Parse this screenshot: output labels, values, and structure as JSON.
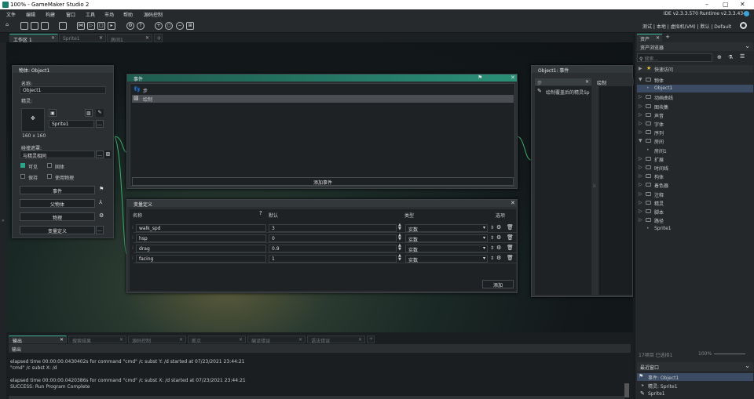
{
  "window": {
    "title": "100% - GameMaker Studio 2"
  },
  "menu": [
    "文件",
    "编辑",
    "构建",
    "窗口",
    "工具",
    "市场",
    "帮助",
    "源码控制"
  ],
  "version": "IDE v2.3.3.570  Runtime v2.3.3.434",
  "toolbar_right": "测试 | 本地 | 虚拟机(VM) | 默认 | Default",
  "workspace_tabs": [
    {
      "label": "工作区 1"
    },
    {
      "label": "Sprite1"
    },
    {
      "label": "房间1"
    }
  ],
  "object_panel": {
    "header": "物体: Object1",
    "name_label": "名称:",
    "name_value": "Object1",
    "sprite_label": "精灵:",
    "sprite_name": "Sprite1",
    "sprite_size": "160 x 160",
    "collision_label": "碰撞遮罩:",
    "collision_value": "与精灵相同",
    "visible": "可见",
    "solid": "固体",
    "persistent": "保持",
    "physics": "使用物理",
    "events_btn": "事件",
    "parent_btn": "父物体",
    "physics_btn": "物理",
    "vardef_btn": "变量定义"
  },
  "events_panel": {
    "header": "事件",
    "items": [
      "步",
      "绘制"
    ],
    "add_btn": "添加事件"
  },
  "code_panel": {
    "header": "Object1: 事件",
    "tab1": "步",
    "tab2": "绘制",
    "event": "绘制覆盖后的精灵Sp"
  },
  "vars_panel": {
    "header": "变量定义",
    "cols": {
      "name": "名称",
      "default": "默认",
      "type": "类型",
      "options": "选项"
    },
    "rows": [
      {
        "name": "walk_spd",
        "value": "3",
        "type": "实数"
      },
      {
        "name": "hsp",
        "value": "0",
        "type": "实数"
      },
      {
        "name": "drag",
        "value": "0.9",
        "type": "实数"
      },
      {
        "name": "facing",
        "value": "1",
        "type": "实数"
      }
    ],
    "add_btn": "添加"
  },
  "output": {
    "tabs": [
      "输出",
      "搜索结果",
      "源码控制",
      "断点",
      "编译错误",
      "语法错误"
    ],
    "subheader": "输出",
    "lines": [
      "elapsed time 00:00:00.0430402s for command \"cmd\" /c subst Y: /d started at 07/23/2021 23:44:21",
      "\"cmd\" /c subst X: /d",
      "elapsed time 00:00:00.0420386s for command \"cmd\" /c subst X: /d started at 07/23/2021 23:44:21",
      "SUCCESS: Run Program Complete"
    ]
  },
  "assets": {
    "tab": "资产",
    "title": "资产浏览器",
    "search_placeholder": "搜索...",
    "quick": "快速访问",
    "tree": [
      {
        "label": "物体",
        "open": true,
        "folder": true
      },
      {
        "label": "Object1",
        "sel": true,
        "child": true
      },
      {
        "label": "动画曲线",
        "folder": true
      },
      {
        "label": "图块集",
        "folder": true
      },
      {
        "label": "声音",
        "folder": true
      },
      {
        "label": "字体",
        "folder": true
      },
      {
        "label": "序列",
        "folder": true
      },
      {
        "label": "房间",
        "open": true,
        "folder": true
      },
      {
        "label": "房间1",
        "child": true
      },
      {
        "label": "扩展",
        "folder": true
      },
      {
        "label": "时间线",
        "folder": true
      },
      {
        "label": "构体",
        "folder": true
      },
      {
        "label": "着色器",
        "folder": true
      },
      {
        "label": "注释",
        "folder": true
      },
      {
        "label": "精灵",
        "folder": true
      },
      {
        "label": "脚本",
        "folder": true
      },
      {
        "label": "路径",
        "folder": true
      },
      {
        "label": "Sprite1",
        "child": true
      }
    ],
    "status": "17项目  已选择1",
    "zoom": "100%",
    "recent_title": "最近窗口",
    "recent": [
      "事件: Object1",
      "精灵: Sprite1",
      "Sprite1"
    ]
  }
}
